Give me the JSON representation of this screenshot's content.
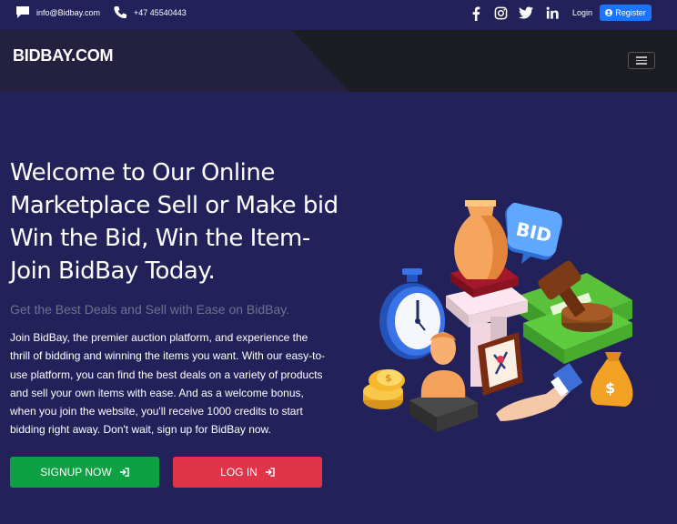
{
  "topbar": {
    "email": "info@Bidbay.com",
    "phone": "+47 45540443",
    "login_label": "Login",
    "register_label": "Register",
    "social_icons": [
      "facebook-icon",
      "instagram-icon",
      "twitter-icon",
      "linkedin-icon"
    ]
  },
  "navbar": {
    "brand": "BIDBAY.COM"
  },
  "hero": {
    "title": "Welcome to Our Online Marketplace Sell or Make bid Win the Bid, Win the Item- Join BidBay Today.",
    "subtitle": "Get the Best Deals and Sell with Ease on BidBay.",
    "body": "Join BidBay, the premier auction platform, and experience the thrill of bidding and winning the items you want. With our easy-to-use platform, you can find the best deals on a variety of products and sell your own items with ease. And as a welcome bonus, when you join the website, you'll receive 1000 credits to start bidding right away. Don't wait, sign up for BidBay now.",
    "signup_label": "SIGNUP NOW",
    "login_label": "LOG IN",
    "bid_bubble_text": "BID"
  },
  "colors": {
    "background": "#23215a",
    "register": "#1a74ff",
    "signup": "#0ea143",
    "login": "#e0344a"
  }
}
